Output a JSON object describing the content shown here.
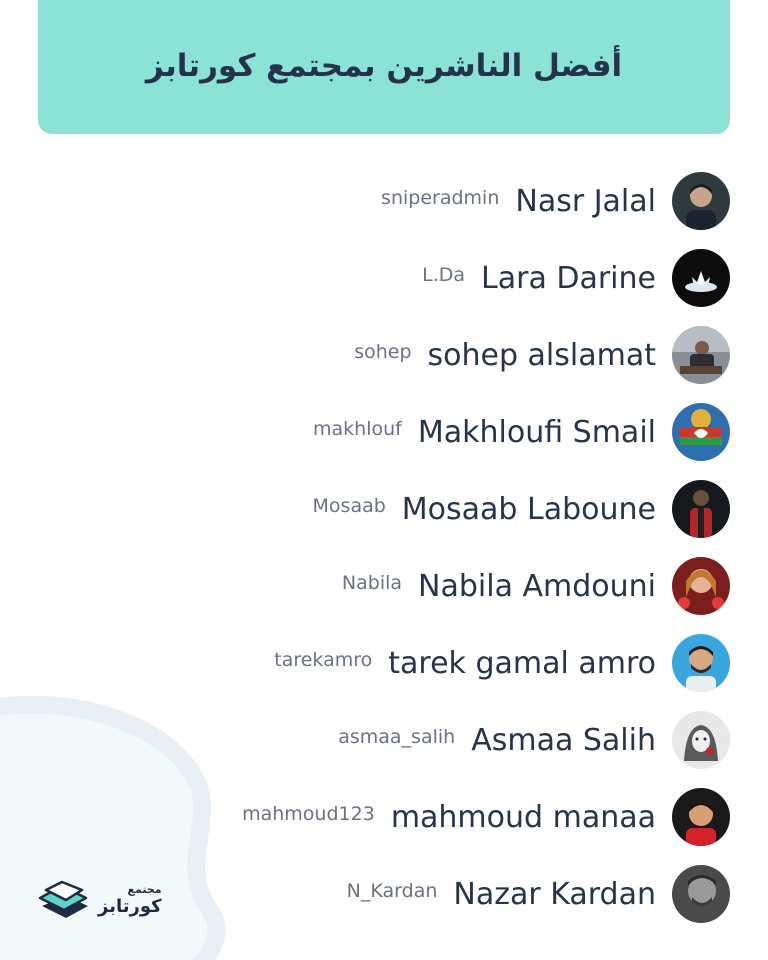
{
  "header": {
    "title": "أفضل الناشرين بمجتمع كورتابز"
  },
  "users": [
    {
      "name": "Nasr Jalal",
      "username": "sniperadmin"
    },
    {
      "name": "Lara Darine",
      "username": "L.Da"
    },
    {
      "name": "sohep alslamat",
      "username": "sohep"
    },
    {
      "name": "Makhloufi Smail",
      "username": "makhlouf"
    },
    {
      "name": "Mosaab Laboune",
      "username": "Mosaab"
    },
    {
      "name": "Nabila Amdouni",
      "username": "Nabila"
    },
    {
      "name": "tarek gamal amro",
      "username": "tarekamro"
    },
    {
      "name": "Asmaa Salih",
      "username": "asmaa_salih"
    },
    {
      "name": "mahmoud manaa",
      "username": "mahmoud123"
    },
    {
      "name": "Nazar Kardan",
      "username": "N_Kardan"
    }
  ],
  "logo": {
    "top": "مجتمع",
    "bottom": "كورتابز"
  },
  "colors": {
    "header_bg": "#8be3d6",
    "text_dark": "#273449",
    "text_muted": "#6b7280",
    "accent": "#5fd3c4"
  },
  "icons": {
    "logo": "stacked-layers-logo-icon",
    "avatar": "user-photo-avatar"
  }
}
